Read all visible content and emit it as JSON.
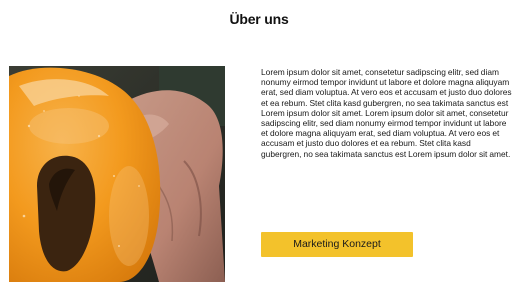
{
  "page": {
    "title": "Über uns"
  },
  "photo": {
    "subject": "hands-shaping-clay-photo"
  },
  "content": {
    "paragraph": "Lorem ipsum dolor sit amet, consetetur sadipscing elitr, sed diam nonumy eirmod tempor invidunt ut labore et dolore magna aliquyam erat, sed diam voluptua. At vero eos et accusam et justo duo dolores et ea rebum. Stet clita kasd gubergren, no sea takimata sanctus est Lorem ipsum dolor sit amet. Lorem ipsum dolor sit amet, consetetur sadipscing elitr, sed diam nonumy eirmod tempor invidunt ut labore et dolore magna aliquyam erat, sed diam voluptua. At vero eos et accusam et justo duo dolores et ea rebum. Stet clita kasd gubergren, no sea takimata sanctus est Lorem ipsum dolor sit amet."
  },
  "cta": {
    "label": "Marketing Konzept"
  },
  "colors": {
    "accent": "#f3c22b",
    "text": "#111111",
    "background": "#ffffff"
  }
}
